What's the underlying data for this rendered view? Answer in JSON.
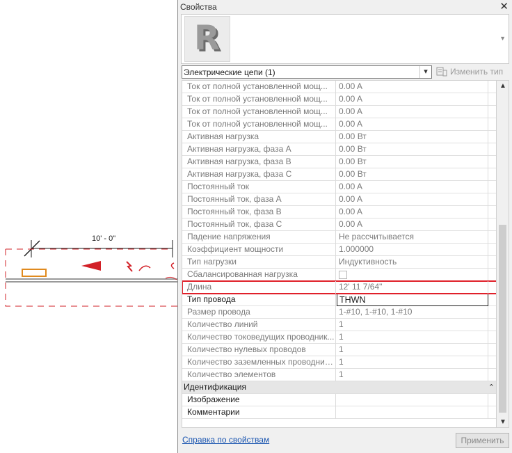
{
  "canvas": {
    "dimension_label": "10' - 0\""
  },
  "panel": {
    "title": "Свойства",
    "close_glyph": "✕",
    "type_icon_letter": "R",
    "type_selector": "Электрические цепи (1)",
    "edit_type_label": "Изменить тип",
    "help_link": "Справка по свойствам",
    "apply_label": "Применить"
  },
  "properties": [
    {
      "name": "Ток от полной установленной мощ...",
      "value": "0.00 A"
    },
    {
      "name": "Ток от полной установленной мощ...",
      "value": "0.00 A"
    },
    {
      "name": "Ток от полной установленной мощ...",
      "value": "0.00 A"
    },
    {
      "name": "Ток от полной установленной мощ...",
      "value": "0.00 A"
    },
    {
      "name": "Активная нагрузка",
      "value": "0.00 Вт"
    },
    {
      "name": "Активная нагрузка, фаза A",
      "value": "0.00 Вт"
    },
    {
      "name": "Активная нагрузка, фаза B",
      "value": "0.00 Вт"
    },
    {
      "name": "Активная нагрузка, фаза C",
      "value": "0.00 Вт"
    },
    {
      "name": "Постоянный ток",
      "value": "0.00 A"
    },
    {
      "name": "Постоянный ток, фаза A",
      "value": "0.00 A"
    },
    {
      "name": "Постоянный ток, фаза B",
      "value": "0.00 A"
    },
    {
      "name": "Постоянный ток, фаза C",
      "value": "0.00 A"
    },
    {
      "name": "Падение напряжения",
      "value": "Не рассчитывается"
    },
    {
      "name": "Коэффициент мощности",
      "value": "1.000000"
    },
    {
      "name": "Тип нагрузки",
      "value": "Индуктивность"
    },
    {
      "name": "Сбалансированная нагрузка",
      "value": ""
    },
    {
      "name": "Длина",
      "value": "12'  11 7/64\""
    },
    {
      "name": "Тип провода",
      "value": "THWN"
    },
    {
      "name": "Размер провода",
      "value": "1-#10, 1-#10, 1-#10"
    },
    {
      "name": "Количество линий",
      "value": "1"
    },
    {
      "name": "Количество токоведущих проводник...",
      "value": "1"
    },
    {
      "name": "Количество нулевых проводов",
      "value": "1"
    },
    {
      "name": "Количество заземленных проводник...",
      "value": "1"
    },
    {
      "name": "Количество элементов",
      "value": "1"
    },
    {
      "name": "Идентификация",
      "value": ""
    },
    {
      "name": "Изображение",
      "value": ""
    },
    {
      "name": "Комментарии",
      "value": ""
    }
  ],
  "colors": {
    "highlight": "#e0202a",
    "canvas_red": "#d22027",
    "tag_orange": "#e08a1e",
    "link": "#1a55b0"
  }
}
